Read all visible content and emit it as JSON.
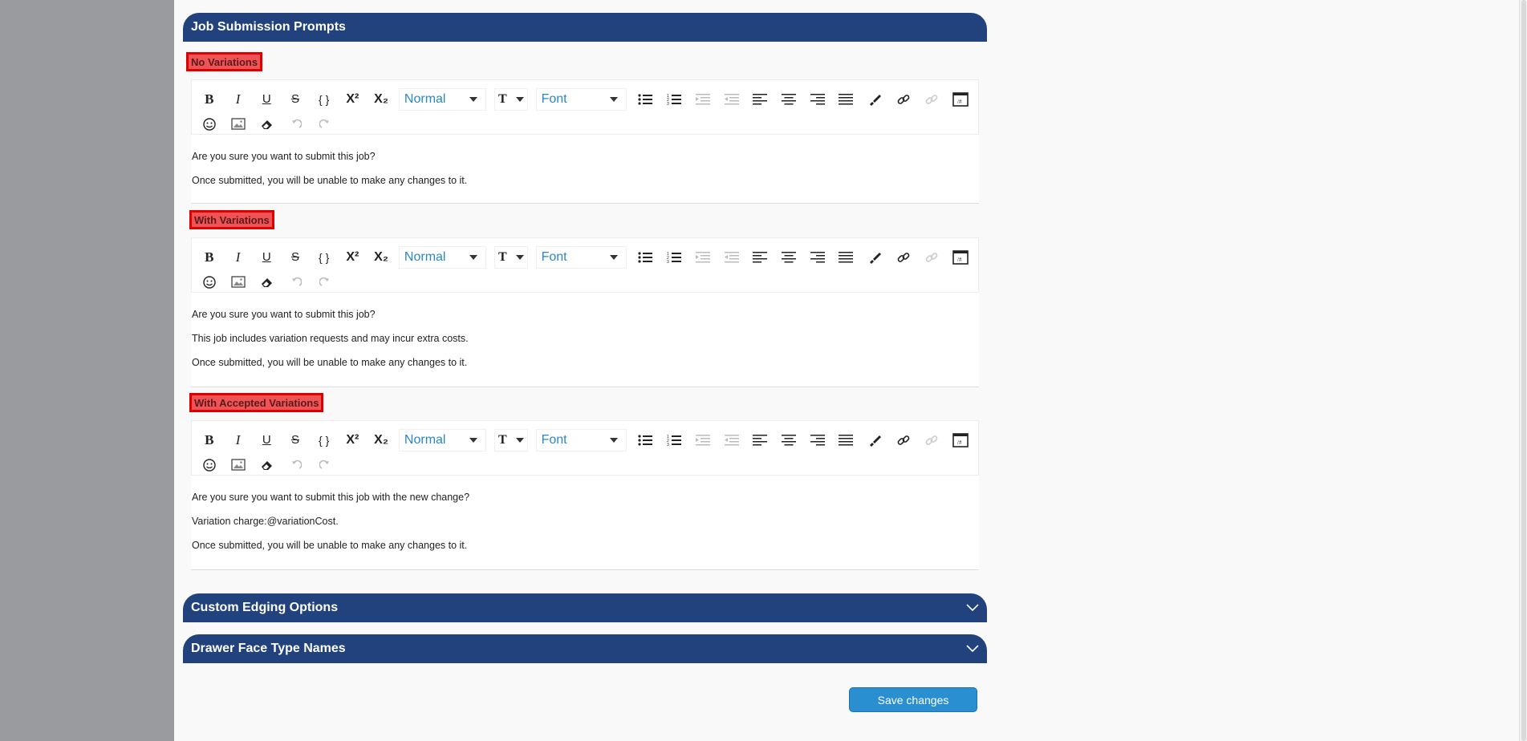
{
  "job_submission": {
    "title": "Job Submission Prompts",
    "sections": [
      {
        "label": "No Variations",
        "lines": [
          "Are you sure you want to submit this job?",
          "Once submitted, you will be unable to make any changes to it."
        ]
      },
      {
        "label": "With Variations",
        "lines": [
          "Are you sure you want to submit this job?",
          "This job includes variation requests and may incur extra costs.",
          "Once submitted, you will be unable to make any changes to it."
        ]
      },
      {
        "label": "With Accepted Variations",
        "lines": [
          "Are you sure you want to submit this job with the new change?",
          "Variation charge:@variationCost.",
          "Once submitted, you will be unable to make any changes to it."
        ]
      }
    ]
  },
  "toolbar": {
    "bold": "B",
    "italic": "I",
    "underline": "U",
    "strike": "S",
    "code": "{ }",
    "superscript": "X²",
    "subscript": "X₂",
    "size_glyph": "T",
    "header_value": "Normal",
    "font_value": "Font"
  },
  "panels": {
    "custom_edging": "Custom Edging Options",
    "drawer_face": "Drawer Face Type Names"
  },
  "save_button": "Save changes",
  "colors": {
    "header_bg": "#21427d",
    "accent": "#2a8fd0",
    "label_bg": "#ef5356",
    "label_border": "#dd0000"
  }
}
